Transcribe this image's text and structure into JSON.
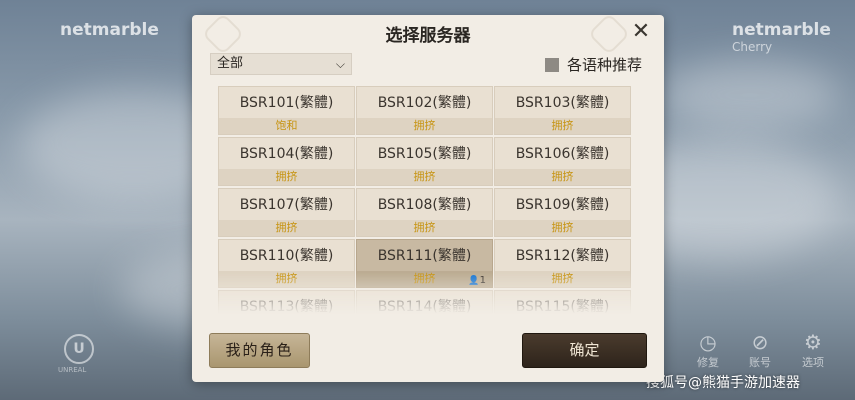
{
  "background": {
    "brand_left": "netmarble",
    "brand_right": "netmarble",
    "brand_right_sub": "Cherry",
    "engine_logo": "U",
    "engine_label": "UNREAL",
    "corner_buttons": [
      {
        "icon": "history-icon",
        "glyph": "◷",
        "label": "修复"
      },
      {
        "icon": "link-icon",
        "glyph": "⊘",
        "label": "账号"
      },
      {
        "icon": "gear-icon",
        "glyph": "⚙",
        "label": "选项"
      }
    ],
    "watermark": "搜狐号@熊猫手游加速器"
  },
  "dialog": {
    "title": "选择服务器",
    "close_glyph": "✕",
    "region_select": {
      "value": "全部",
      "chevron": "⌵"
    },
    "language_option": {
      "label": "各语种推荐",
      "checked": false
    },
    "servers": [
      {
        "name": "BSR101(繁體)",
        "status": "饱和",
        "selected": false
      },
      {
        "name": "BSR102(繁體)",
        "status": "拥挤",
        "selected": false
      },
      {
        "name": "BSR103(繁體)",
        "status": "拥挤",
        "selected": false
      },
      {
        "name": "BSR104(繁體)",
        "status": "拥挤",
        "selected": false
      },
      {
        "name": "BSR105(繁體)",
        "status": "拥挤",
        "selected": false
      },
      {
        "name": "BSR106(繁體)",
        "status": "拥挤",
        "selected": false
      },
      {
        "name": "BSR107(繁體)",
        "status": "拥挤",
        "selected": false
      },
      {
        "name": "BSR108(繁體)",
        "status": "拥挤",
        "selected": false
      },
      {
        "name": "BSR109(繁體)",
        "status": "拥挤",
        "selected": false
      },
      {
        "name": "BSR110(繁體)",
        "status": "拥挤",
        "selected": false
      },
      {
        "name": "BSR111(繁體)",
        "status": "拥挤",
        "selected": true,
        "characters": "1"
      },
      {
        "name": "BSR112(繁體)",
        "status": "拥挤",
        "selected": false
      },
      {
        "name": "BSR113(繁體)",
        "status": "",
        "selected": false
      },
      {
        "name": "BSR114(繁體)",
        "status": "",
        "selected": false
      },
      {
        "name": "BSR115(繁體)",
        "status": "",
        "selected": false
      }
    ],
    "my_characters_label": "我的角色",
    "confirm_label": "确定"
  },
  "colors": {
    "status_text": "#c79412",
    "confirm_bg": "#2e241b",
    "dialog_bg": "#f2ede5"
  }
}
